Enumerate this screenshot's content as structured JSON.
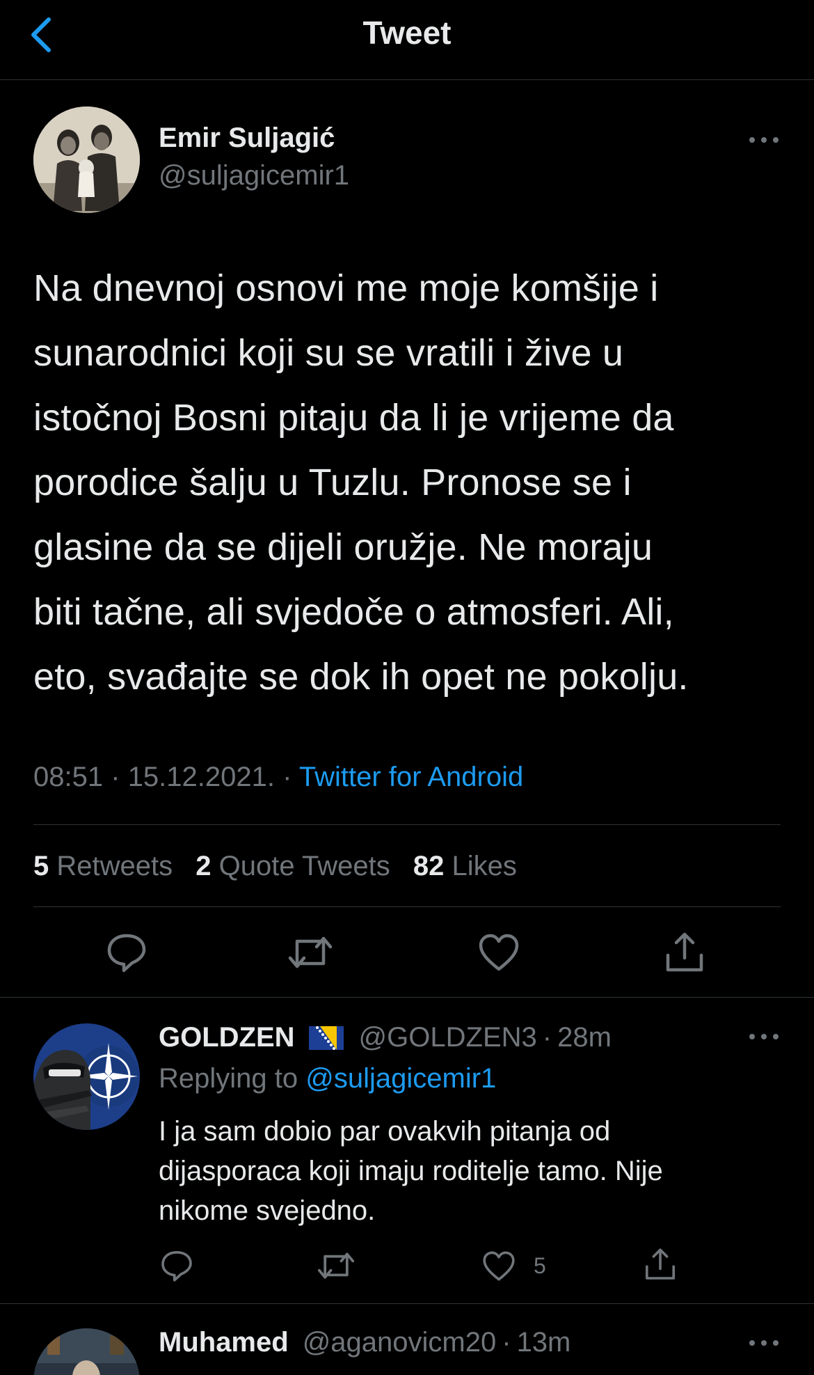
{
  "header": {
    "title": "Tweet",
    "back_icon": "chevron-left-icon"
  },
  "main_tweet": {
    "author_name": "Emir Suljagić",
    "author_handle": "@suljagicemir1",
    "text_lines": [
      "Na dnevnoj osnovi me moje komšije i",
      "sunarodnici koji su se vratili i žive u",
      "istočnoj Bosni pitaju da li je vrijeme da",
      "porodice šalju u Tuzlu. Pronose se i",
      "glasine da se dijeli oružje. Ne moraju",
      "biti tačne, ali svjedoče o atmosferi. Ali,",
      "eto, svađajte se dok ih opet ne pokolju."
    ],
    "time": "08:51",
    "date": "15.12.2021.",
    "separator": "·",
    "source": "Twitter for Android",
    "stats": {
      "retweets_count": "5",
      "retweets_label": "Retweets",
      "quotes_count": "2",
      "quotes_label": "Quote Tweets",
      "likes_count": "82",
      "likes_label": "Likes"
    }
  },
  "replies": [
    {
      "name": "GOLDZEN",
      "flag": "bosnia-flag",
      "handle": "@GOLDZEN3",
      "time": "28m",
      "replying_label": "Replying to",
      "replying_to": "@suljagicemir1",
      "text_lines": [
        "I ja sam dobio par ovakvih pitanja od",
        "dijasporaca koji imaju roditelje tamo. Nije",
        "nikome svejedno."
      ],
      "like_count": "5"
    },
    {
      "name": "Muhamed",
      "handle": "@aganovicm20",
      "time": "13m"
    }
  ],
  "colors": {
    "background": "#000000",
    "accent": "#1d9bf0",
    "secondary_text": "#71767b",
    "divider": "#2f3336"
  }
}
